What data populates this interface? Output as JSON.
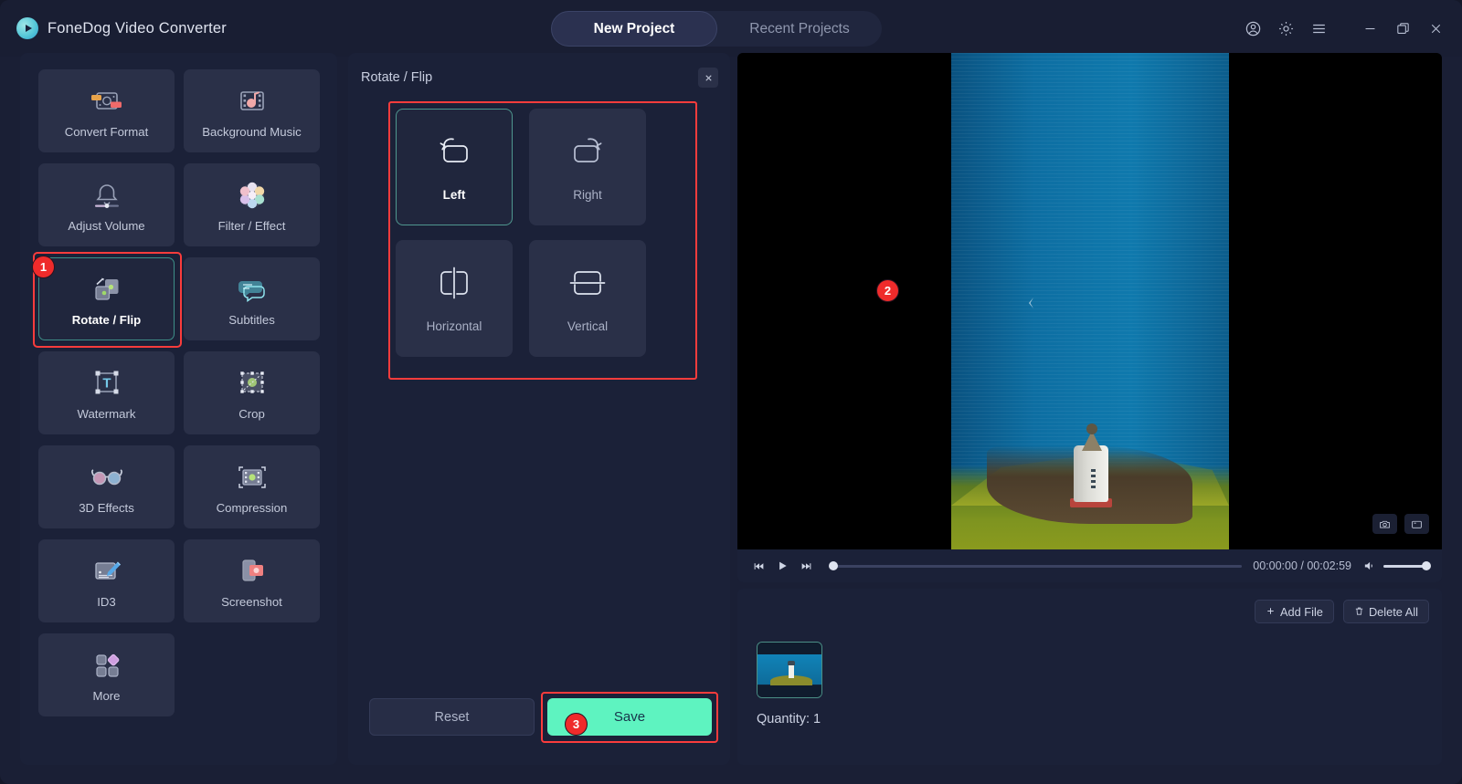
{
  "app": {
    "brand": "FoneDog Video Converter",
    "logo_icon": "play-circle-logo"
  },
  "titlebar": {
    "tabs": [
      {
        "label": "New Project",
        "active": true
      },
      {
        "label": "Recent Projects",
        "active": false
      }
    ],
    "controls": [
      {
        "name": "account-icon"
      },
      {
        "name": "gear-icon"
      },
      {
        "name": "menu-icon"
      },
      {
        "name": "minimize-icon"
      },
      {
        "name": "maximize-icon"
      },
      {
        "name": "close-icon"
      }
    ]
  },
  "sidebar": {
    "tools": [
      {
        "label": "Convert Format",
        "icon": "convert-format-icon",
        "selected": false
      },
      {
        "label": "Background Music",
        "icon": "background-music-icon",
        "selected": false
      },
      {
        "label": "Adjust Volume",
        "icon": "adjust-volume-icon",
        "selected": false
      },
      {
        "label": "Filter / Effect",
        "icon": "filter-effect-icon",
        "selected": false
      },
      {
        "label": "Rotate / Flip",
        "icon": "rotate-flip-icon",
        "selected": true,
        "badge": "1"
      },
      {
        "label": "Subtitles",
        "icon": "subtitles-icon",
        "selected": false
      },
      {
        "label": "Watermark",
        "icon": "watermark-icon",
        "selected": false
      },
      {
        "label": "Crop",
        "icon": "crop-icon",
        "selected": false
      },
      {
        "label": "3D Effects",
        "icon": "3d-effects-icon",
        "selected": false
      },
      {
        "label": "Compression",
        "icon": "compression-icon",
        "selected": false
      },
      {
        "label": "ID3",
        "icon": "id3-icon",
        "selected": false
      },
      {
        "label": "Screenshot",
        "icon": "screenshot-icon",
        "selected": false
      },
      {
        "label": "More",
        "icon": "more-icon",
        "selected": false
      }
    ]
  },
  "panel": {
    "title": "Rotate / Flip",
    "close_icon": "close-icon",
    "highlight_badge": "2",
    "options": [
      {
        "label": "Left",
        "icon": "rotate-left-icon",
        "selected": true
      },
      {
        "label": "Right",
        "icon": "rotate-right-icon",
        "selected": false
      },
      {
        "label": "Horizontal",
        "icon": "flip-horizontal-icon",
        "selected": false
      },
      {
        "label": "Vertical",
        "icon": "flip-vertical-icon",
        "selected": false
      }
    ],
    "reset_label": "Reset",
    "save_label": "Save",
    "save_badge": "3",
    "colors": {
      "save_button": "#5ef3c0",
      "highlight": "#fa3c3c",
      "selected_border": "#4f978f",
      "badge": "#ef2b2b"
    }
  },
  "preview": {
    "snapshot_icon": "camera-icon",
    "fullscreen_icon": "expand-icon",
    "controls": {
      "prev_icon": "skip-back-icon",
      "play_icon": "play-icon",
      "next_icon": "skip-forward-icon",
      "volume_icon": "volume-icon",
      "timecode": "00:00:00 / 00:02:59",
      "progress_percent": 0,
      "volume_percent": 100
    }
  },
  "filelist": {
    "add_file_label": "Add File",
    "add_file_icon": "plus-icon",
    "delete_all_label": "Delete All",
    "delete_all_icon": "trash-icon",
    "thumbnail_name": "video-thumbnail",
    "quantity": "Quantity: 1"
  }
}
